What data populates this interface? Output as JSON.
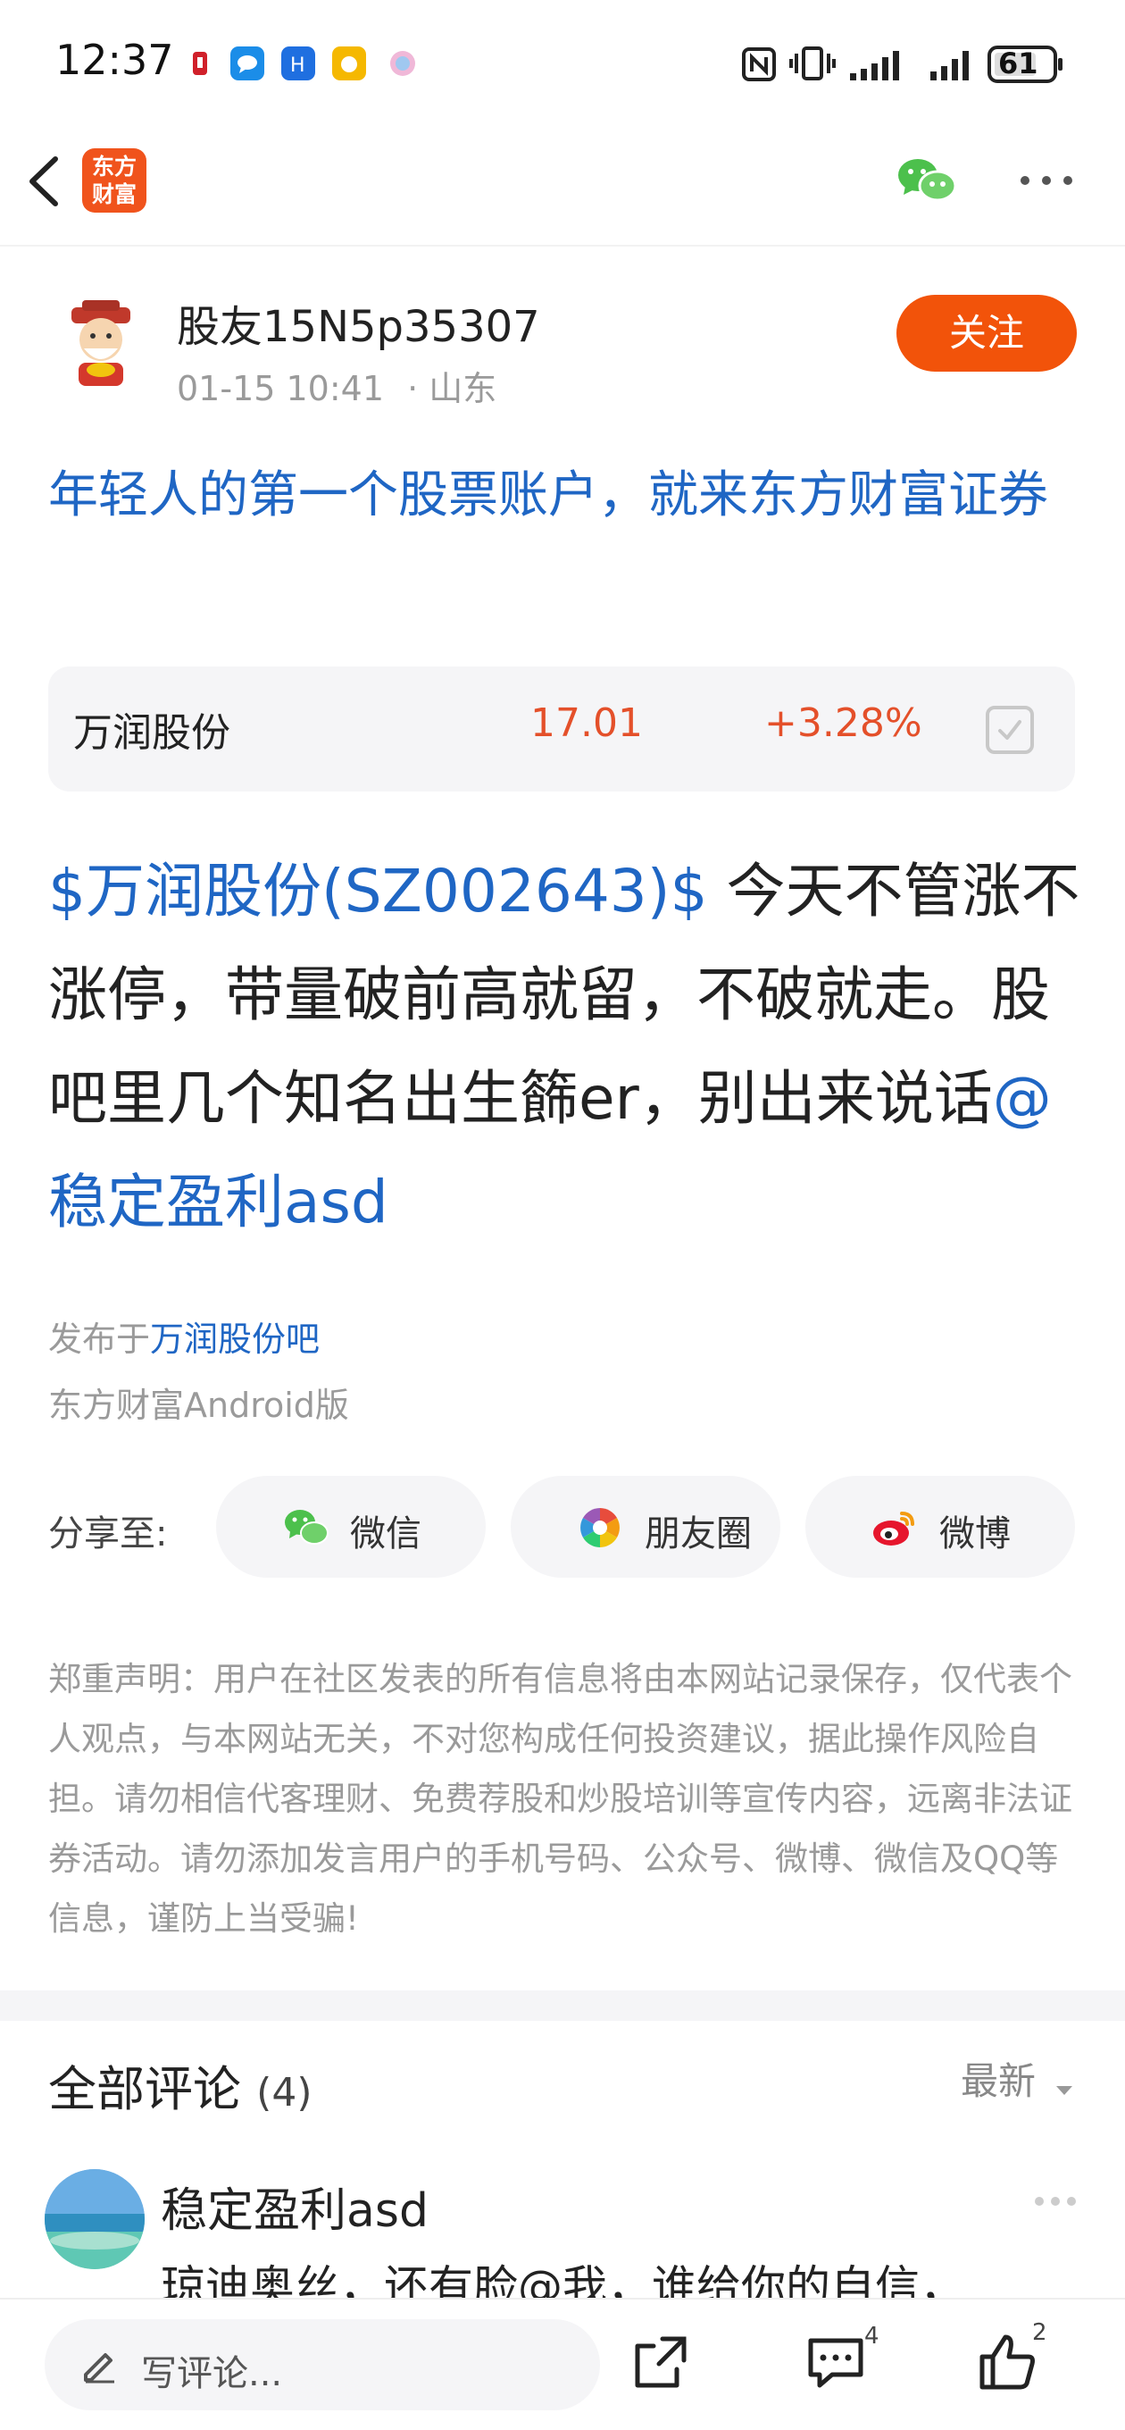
{
  "status_bar": {
    "time": "12:37",
    "battery": "61",
    "icons": [
      "app-notification-icon",
      "message-icon",
      "app-icon",
      "app-icon",
      "app-icon",
      "nfc-icon",
      "vibrate-icon",
      "signal-icon",
      "signal-icon",
      "battery-icon"
    ]
  },
  "nav": {
    "logo_line1": "东方",
    "logo_line2": "财富",
    "icons": [
      "back-icon",
      "wechat-share-icon",
      "more-icon"
    ]
  },
  "author": {
    "name": "股友15N5p35307",
    "time": "01-15 10:41",
    "location": "· 山东",
    "follow_label": "关注"
  },
  "ad_title": "年轻人的第一个股票账户，就来东方财富证券",
  "stock_card": {
    "name": "万润股份",
    "price": "17.01",
    "change": "+3.28%"
  },
  "post": {
    "stock_tag": "$万润股份(SZ002643)$",
    "text": " 今天不管涨不涨停，带量破前高就留，不破就走。股吧里几个知名出生籂er，别出来说话",
    "mention": "@稳定盈利asd"
  },
  "source": {
    "published_prefix": "发布于",
    "forum": "万润股份吧",
    "client": "东方财富Android版"
  },
  "share": {
    "label": "分享至:",
    "buttons": [
      {
        "label": "微信",
        "icon": "wechat-icon"
      },
      {
        "label": "朋友圈",
        "icon": "moments-icon"
      },
      {
        "label": "微博",
        "icon": "weibo-icon"
      }
    ]
  },
  "disclaimer": "郑重声明：用户在社区发表的所有信息将由本网站记录保存，仅代表个人观点，与本网站无关，不对您构成任何投资建议，据此操作风险自担。请勿相信代客理财、免费荐股和炒股培训等宣传内容，远离非法证券活动。请勿添加发言用户的手机号码、公众号、微博、微信及QQ等信息，谨防上当受骗!",
  "comments": {
    "title": "全部评论",
    "count": "(4)",
    "sort": "最新",
    "items": [
      {
        "user": "稳定盈利asd",
        "text": "琼迪奥丝，还有脸@我，谁给你的自信，"
      }
    ]
  },
  "bottom_bar": {
    "comment_placeholder": "写评论...",
    "comment_count": "4",
    "like_count": "2"
  },
  "colors": {
    "accent_orange": "#f2530a",
    "link_blue": "#1f66c4",
    "price_red": "#e4502a"
  }
}
